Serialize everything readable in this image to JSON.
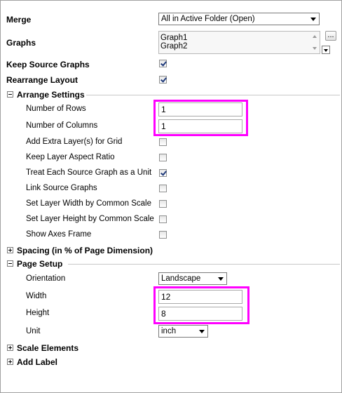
{
  "merge": {
    "label": "Merge",
    "value": "All in Active Folder (Open)"
  },
  "graphs": {
    "label": "Graphs",
    "items": [
      "Graph1",
      "Graph2"
    ],
    "browse_label": "..."
  },
  "keep_source_graphs": {
    "label": "Keep Source Graphs",
    "checked": true
  },
  "rearrange_layout": {
    "label": "Rearrange Layout",
    "checked": true
  },
  "arrange_settings": {
    "title": "Arrange Settings",
    "rows_label": "Number of Rows",
    "rows_value": "1",
    "cols_label": "Number of Columns",
    "cols_value": "1",
    "extra_layers_label": "Add Extra Layer(s) for Grid",
    "keep_aspect_label": "Keep Layer Aspect Ratio",
    "treat_unit_label": "Treat Each Source Graph as a Unit",
    "link_source_label": "Link Source Graphs",
    "layer_width_label": "Set Layer Width by Common Scale",
    "layer_height_label": "Set Layer Height by Common Scale",
    "show_axes_label": "Show Axes Frame"
  },
  "spacing": {
    "title": "Spacing (in % of Page Dimension)"
  },
  "page_setup": {
    "title": "Page Setup",
    "orientation_label": "Orientation",
    "orientation_value": "Landscape",
    "width_label": "Width",
    "width_value": "12",
    "height_label": "Height",
    "height_value": "8",
    "unit_label": "Unit",
    "unit_value": "inch"
  },
  "scale_elements": {
    "title": "Scale Elements"
  },
  "add_label": {
    "title": "Add Label"
  },
  "colors": {
    "highlight": "#ff00ff",
    "check": "#1f3a7a"
  }
}
